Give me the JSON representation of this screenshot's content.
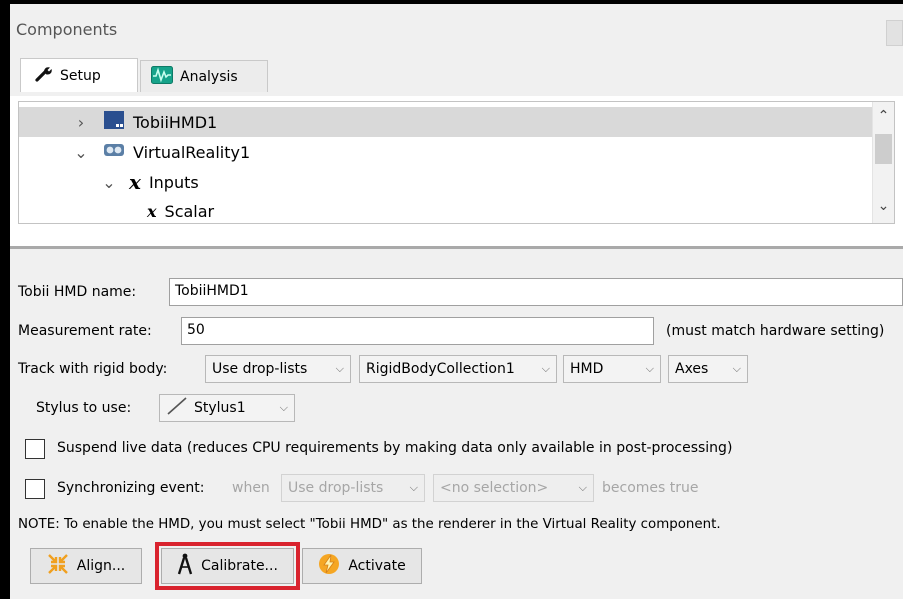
{
  "window": {
    "title": "Components"
  },
  "tabs": [
    {
      "label": "Setup",
      "icon": "wrench-icon"
    },
    {
      "label": "Analysis",
      "icon": "waveform-icon"
    }
  ],
  "tree": {
    "items": [
      {
        "label": "TobiiHMD1",
        "expanded": false,
        "selected": true,
        "icon": "hmd-device-icon"
      },
      {
        "label": "VirtualReality1",
        "expanded": true,
        "icon": "vr-headset-icon"
      },
      {
        "label": "Inputs",
        "expanded": true,
        "icon": "variable-x-icon"
      },
      {
        "label": "Scalar",
        "icon": "variable-x-icon"
      }
    ]
  },
  "form": {
    "name_label": "Tobii HMD name:",
    "name_value": "TobiiHMD1",
    "rate_label": "Measurement rate:",
    "rate_value": "50",
    "rate_note": "(must match hardware setting)",
    "track_label": "Track with rigid body:",
    "track_mode": "Use drop-lists",
    "rigid_collection": "RigidBodyCollection1",
    "rigid_body": "HMD",
    "rigid_axes": "Axes",
    "stylus_label": "Stylus to use:",
    "stylus_value": "Stylus1",
    "suspend_label": "Suspend live data (reduces CPU requirements by making data only available in post-processing)",
    "sync_label": "Synchronizing event:",
    "sync_when": "when",
    "sync_mode": "Use drop-lists",
    "sync_selection": "<no selection>",
    "sync_becomes": "becomes true",
    "note": "NOTE: To enable the HMD, you must select \"Tobii HMD\" as the renderer in the Virtual Reality component."
  },
  "buttons": {
    "align": "Align...",
    "calibrate": "Calibrate...",
    "activate": "Activate"
  },
  "colors": {
    "highlight": "#d9232e",
    "panel_bg": "#f0f0f0",
    "selected_row": "#d9d9d9"
  }
}
